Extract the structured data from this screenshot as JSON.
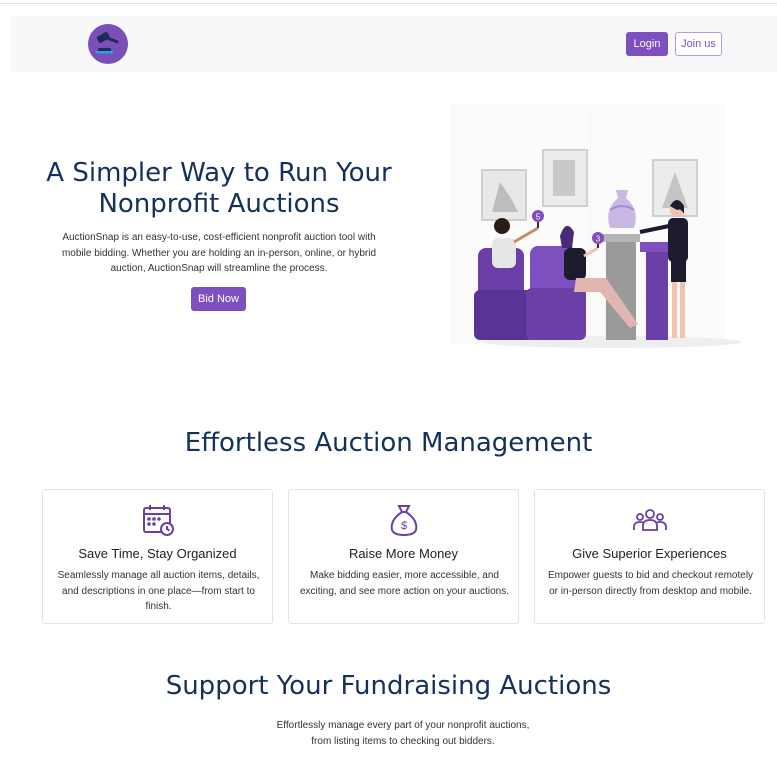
{
  "nav": {
    "login_label": "Login",
    "join_label": "Join us",
    "logo_icon": "gavel-icon"
  },
  "hero": {
    "title": "A Simpler Way to Run Your Nonprofit Auctions",
    "description": "AuctionSnap is an easy-to-use, cost-efficient nonprofit auction tool with mobile bidding. Whether you are holding an in-person, online, or hybrid auction, AuctionSnap will streamline the process.",
    "cta_label": "Bid Now",
    "paddle_1": "5",
    "paddle_2": "3"
  },
  "management": {
    "title": "Effortless Auction Management",
    "cards": [
      {
        "icon": "calendar-clock-icon",
        "title": "Save Time, Stay Organized",
        "description": "Seamlessly manage all auction items, details, and descriptions in one place—from start to finish."
      },
      {
        "icon": "money-bag-icon",
        "title": "Raise More Money",
        "description": "Make bidding easier, more accessible, and exciting, and see more action on your auctions."
      },
      {
        "icon": "group-people-icon",
        "title": "Give Superior Experiences",
        "description": "Empower guests to bid and checkout remotely or in-person directly from desktop and mobile."
      }
    ]
  },
  "support": {
    "title": "Support Your Fundraising Auctions",
    "description": "Effortlessly manage every part of your nonprofit auctions, from listing items to checking out bidders."
  },
  "colors": {
    "brand_purple": "#7e4fbe",
    "heading_navy": "#14315d",
    "nav_bg": "#f7f8fa"
  }
}
